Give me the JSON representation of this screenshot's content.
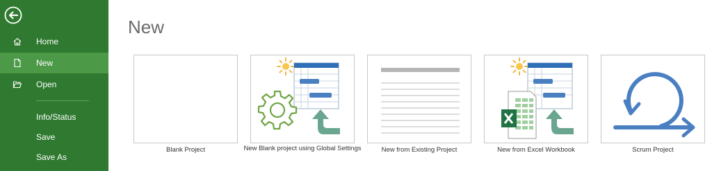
{
  "sidebar": {
    "items": [
      {
        "label": "Home",
        "icon": "home-icon"
      },
      {
        "label": "New",
        "icon": "new-document-icon"
      },
      {
        "label": "Open",
        "icon": "open-folder-icon"
      }
    ],
    "secondary": [
      {
        "label": "Info/Status"
      },
      {
        "label": "Save"
      },
      {
        "label": "Save As"
      }
    ],
    "active": "New",
    "colors": {
      "background": "#2f7a30",
      "active": "#4c9a48"
    }
  },
  "main": {
    "title": "New",
    "templates": [
      {
        "label": "Blank Project"
      },
      {
        "label": "New Blank project using Global Settings"
      },
      {
        "label": "New from Existing Project"
      },
      {
        "label": "New from Excel Workbook"
      },
      {
        "label": "Scrum Project"
      }
    ]
  }
}
